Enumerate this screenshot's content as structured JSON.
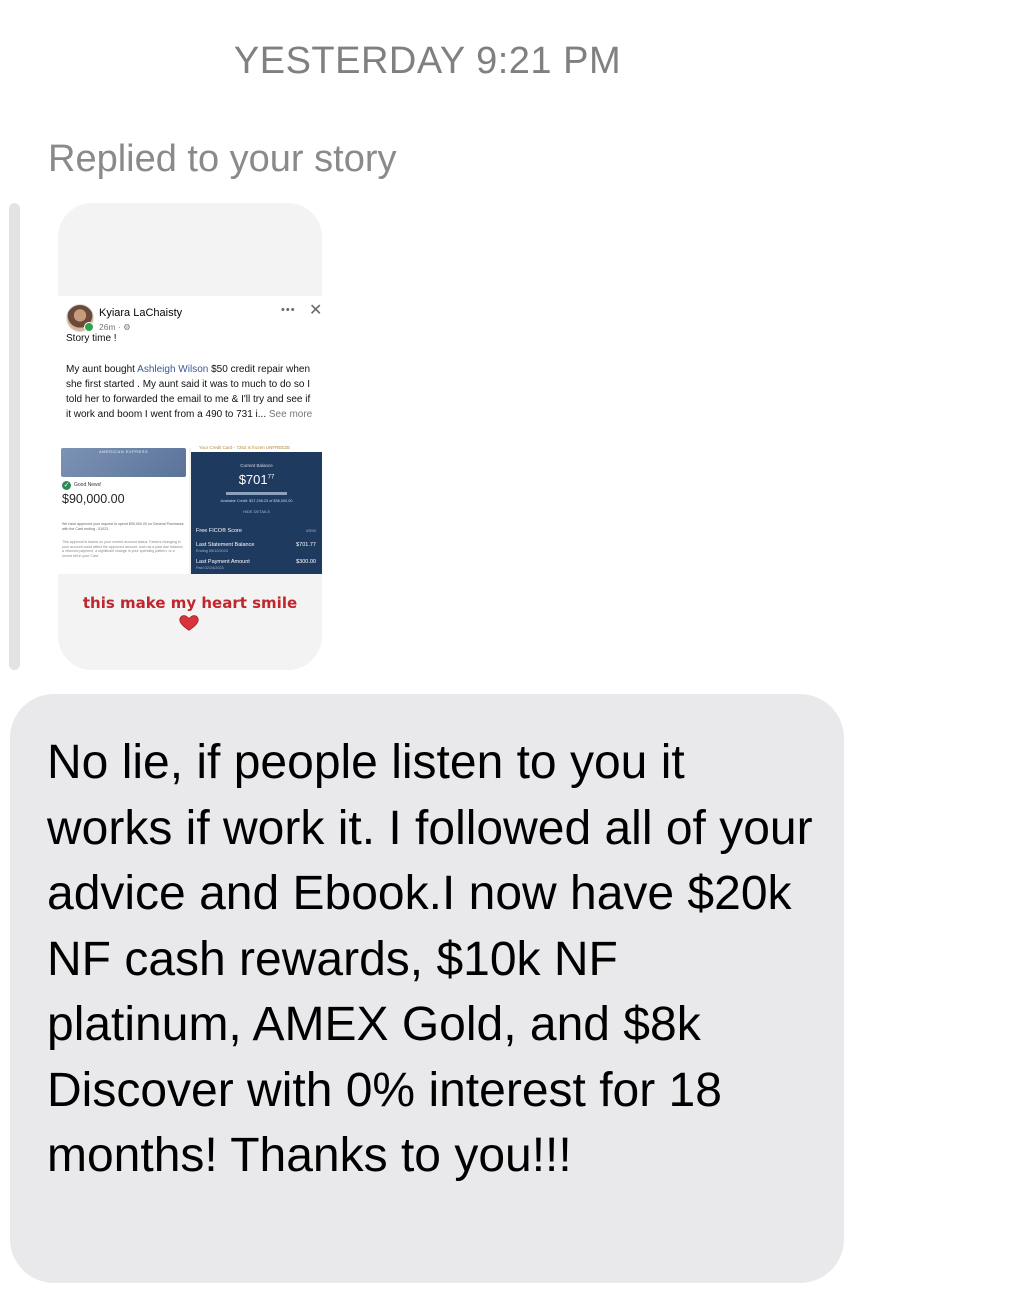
{
  "header": {
    "timestamp": "YESTERDAY 9:21 PM"
  },
  "reply_label": "Replied to your story",
  "story": {
    "author": "Kyiara LaChaisty",
    "age": "26m · ⚙",
    "title": "Story time !",
    "body_prefix": "My aunt bought ",
    "body_link": "Ashleigh Wilson",
    "body_rest": " $50 credit repair when she first started . My aunt said it was to much to do so I told her to forwarded the email to me & I'll try and see if it work and boom I went from a 490 to 731 i...",
    "see_more": " See more",
    "card_brand": "AMERICAN EXPRESS",
    "good_news": "Good News!",
    "approved_amount": "$90,000.00",
    "approval_note": "We have approved your request to spend $90,000.00 on General Purchases with the Card ending - 51023.",
    "fine_print": "This approval is based on your current account status. Factors changing in your account could affect the approved amount, such as a past due balance, a returned payment, a significant change in your spending pattern, or a recent fall in your Card.",
    "credit_card_label": "Your Credit Card - 7262 is frozen  UNFREEZE",
    "current_balance_label": "Current Balance",
    "score_value": "701",
    "score_cents": "77",
    "available_credit": "Available Credit: $37,298.23 of $38,000.00",
    "hide_details": "HIDE DETAILS",
    "fico_label": "Free FICO® Score",
    "fico_action": "VIEW",
    "last_statement_label": "Last Statement Balance",
    "last_statement_date": "Ending 05/12/2023",
    "last_statement_value": "$701.77",
    "last_payment_label": "Last Payment Amount",
    "last_payment_date": "Paid 02/24/2023",
    "last_payment_value": "$300.00",
    "caption": "this make my heart smile"
  },
  "message": {
    "text": "No lie, if people listen to you it works if work it. I followed all of your advice and Ebook.I now have $20k NF cash rewards, $10k NF platinum, AMEX Gold, and $8k Discover with 0% interest for 18 months! Thanks to you!!!"
  },
  "colors": {
    "bubble": "#e9e9eb",
    "timestamp": "#808080",
    "caption": "#c0262d",
    "score_panel": "#1f3a5f"
  }
}
